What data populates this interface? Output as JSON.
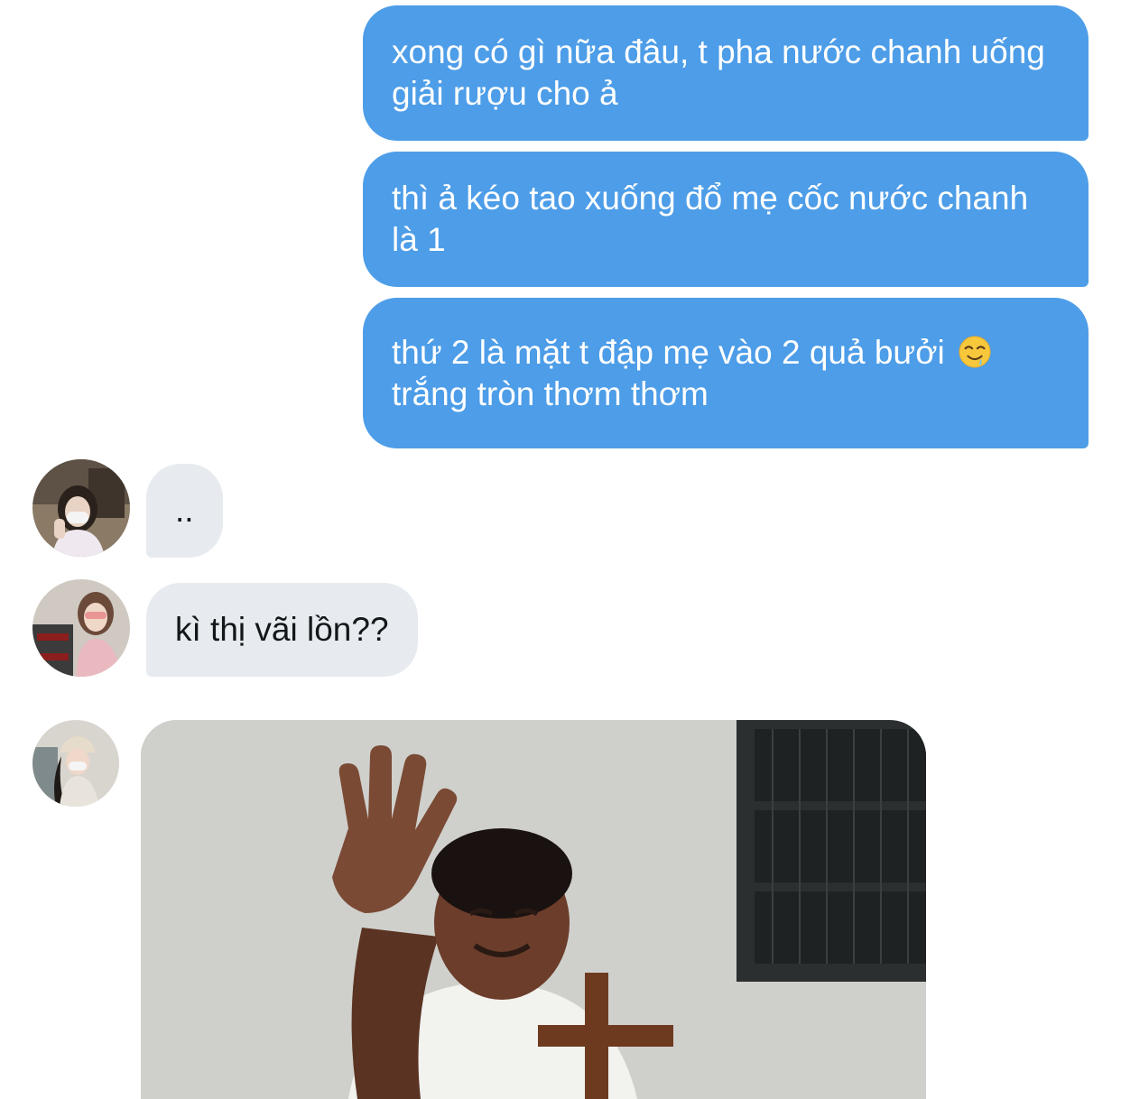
{
  "messages": {
    "out1": "xong có gì nữa đâu, t pha nước chanh uống giải rượu cho ả",
    "out2": "thì ả kéo tao xuống đổ mẹ cốc nước chanh là 1",
    "out3": "thứ 2 là mặt t đập mẹ vào 2 quả bưởi",
    "out3_line2": "trắng tròn thơm thơm",
    "in1": "..",
    "in2": "kì thị vãi lồn??"
  },
  "icons": {
    "out3_emoji": "drooling-face-emoji"
  },
  "colors": {
    "outgoing_bubble": "#4d9de8",
    "incoming_bubble": "#e7ebef",
    "background": "#ffffff"
  }
}
